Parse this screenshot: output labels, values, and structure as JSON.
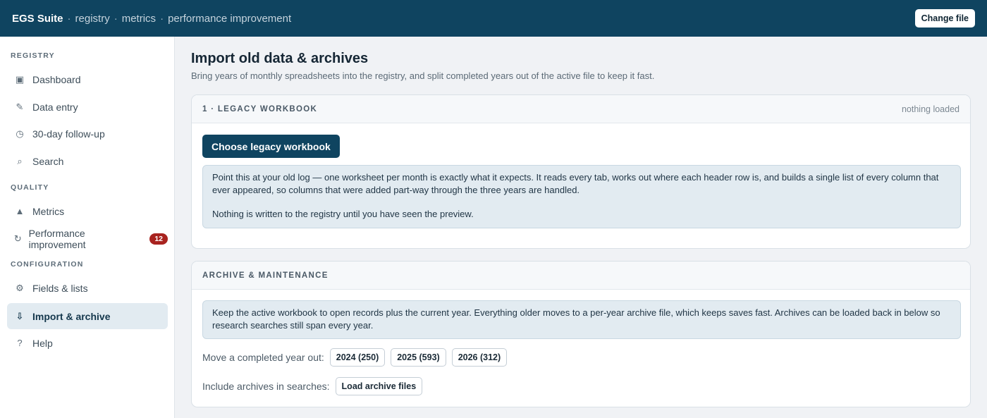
{
  "topbar": {
    "brand": "EGS Suite",
    "separator": "·",
    "breadcrumbs": [
      "registry",
      "metrics",
      "performance improvement"
    ],
    "change_file_label": "Change file"
  },
  "sidebar": {
    "sections": [
      {
        "label": "REGISTRY",
        "items": [
          {
            "label": "Dashboard",
            "icon": "square-icon",
            "glyph": "▣"
          },
          {
            "label": "Data entry",
            "icon": "pencil-icon",
            "glyph": "✎"
          },
          {
            "label": "30-day follow-up",
            "icon": "clock-icon",
            "glyph": "◷"
          },
          {
            "label": "Search",
            "icon": "search-icon",
            "glyph": "⌕"
          }
        ]
      },
      {
        "label": "QUALITY",
        "items": [
          {
            "label": "Metrics",
            "icon": "triangle-icon",
            "glyph": "▲"
          },
          {
            "label": "Performance improvement",
            "icon": "refresh-icon",
            "glyph": "↻",
            "badge": "12"
          }
        ]
      },
      {
        "label": "CONFIGURATION",
        "items": [
          {
            "label": "Fields & lists",
            "icon": "gear-icon",
            "glyph": "⚙"
          },
          {
            "label": "Import & archive",
            "icon": "download-icon",
            "glyph": "⇩",
            "active": true
          },
          {
            "label": "Help",
            "icon": "question-icon",
            "glyph": "?"
          }
        ]
      }
    ]
  },
  "main": {
    "title": "Import old data & archives",
    "subtitle": "Bring years of monthly spreadsheets into the registry, and split completed years out of the active file to keep it fast.",
    "legacy": {
      "title": "1 · LEGACY WORKBOOK",
      "status": "nothing loaded",
      "button": "Choose legacy workbook",
      "info_p1": "Point this at your old log — one worksheet per month is exactly what it expects. It reads every tab, works out where each header row is, and builds a single list of every column that ever appeared, so columns that were added part-way through the three years are handled.",
      "info_p2": "Nothing is written to the registry until you have seen the preview."
    },
    "archive": {
      "title": "ARCHIVE & MAINTENANCE",
      "info": "Keep the active workbook to open records plus the current year. Everything older moves to a per-year archive file, which keeps saves fast. Archives can be loaded back in below so research searches still span every year.",
      "move_label": "Move a completed year out:",
      "years": [
        "2024 (250)",
        "2025 (593)",
        "2026 (312)"
      ],
      "include_label": "Include archives in searches:",
      "load_button": "Load archive files"
    }
  },
  "colors": {
    "topbar": "#0f4460",
    "primary": "#0f4460",
    "badge": "#a8231f",
    "active_nav": "#e2ebf1",
    "info_box": "#e2ebf1"
  }
}
